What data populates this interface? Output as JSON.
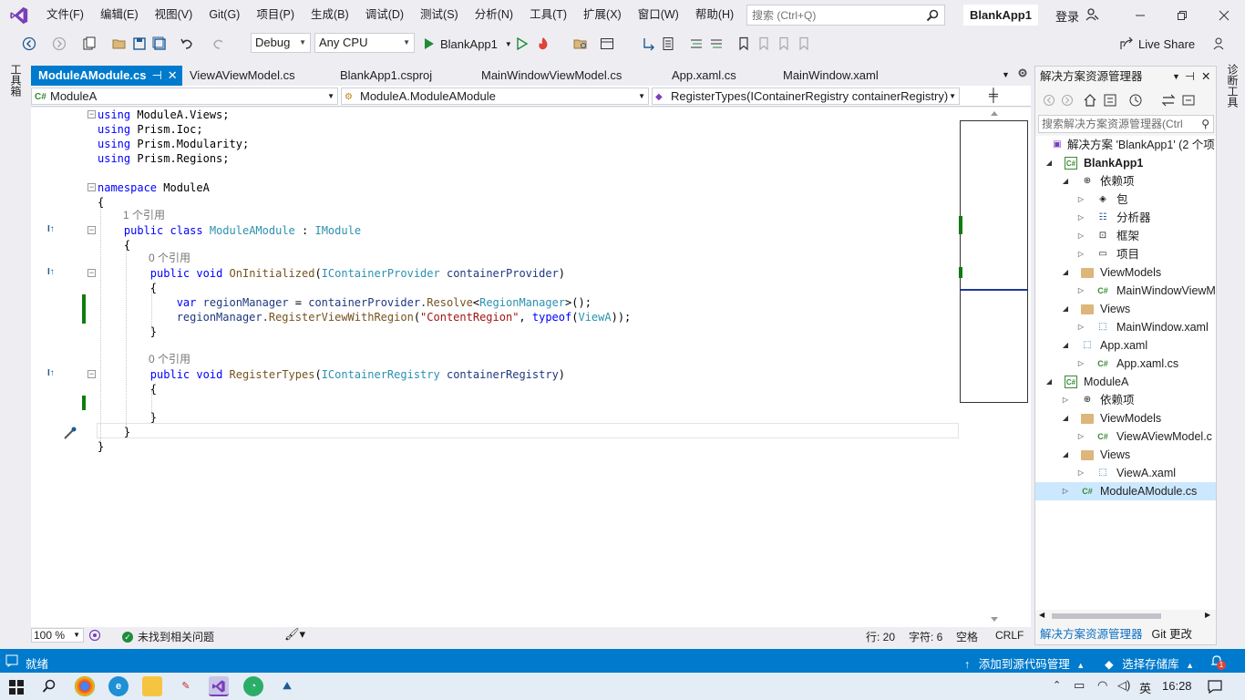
{
  "menubar": {
    "items": [
      "文件(F)",
      "编辑(E)",
      "视图(V)",
      "Git(G)",
      "项目(P)",
      "生成(B)",
      "调试(D)",
      "测试(S)",
      "分析(N)",
      "工具(T)",
      "扩展(X)",
      "窗口(W)",
      "帮助(H)"
    ],
    "search_placeholder": "搜索 (Ctrl+Q)",
    "solution_name": "BlankApp1",
    "login": "登录"
  },
  "toolbar": {
    "config": "Debug",
    "platform": "Any CPU",
    "run_target": "BlankApp1",
    "live_share": "Live Share"
  },
  "left_strip": {
    "toolbox": "工具箱"
  },
  "right_strip": {
    "diagnostics": "诊断工具"
  },
  "doc_tabs": [
    {
      "label": "ModuleAModule.cs",
      "active": true
    },
    {
      "label": "ViewAViewModel.cs"
    },
    {
      "label": "BlankApp1.csproj"
    },
    {
      "label": "MainWindowViewModel.cs"
    },
    {
      "label": "App.xaml.cs"
    },
    {
      "label": "MainWindow.xaml"
    }
  ],
  "nav_bar": {
    "project": "ModuleA",
    "type": "ModuleA.ModuleAModule",
    "member": "RegisterTypes(IContainerRegistry containerRegistry)"
  },
  "code": {
    "using1": "using",
    "ns1": "ModuleA.Views;",
    "using2": "using",
    "ns2": "Prism.Ioc;",
    "using3": "using",
    "ns3": "Prism.Modularity;",
    "using4": "using",
    "ns4": "Prism.Regions;",
    "namespace_kw": "namespace",
    "namespace_name": "ModuleA",
    "ref1": "1 个引用",
    "ref2": "0 个引用",
    "ref3": "0 个引用",
    "public": "public",
    "class": "class",
    "void": "void",
    "var": "var",
    "typeof": "typeof",
    "class_name": "ModuleAModule",
    "colon": ":",
    "interface": "IModule",
    "m1": "OnInitialized",
    "m1_ptype": "IContainerProvider",
    "m1_pname": "containerProvider",
    "m2": "RegisterTypes",
    "m2_ptype": "IContainerRegistry",
    "m2_pname": "containerRegistry",
    "l_var_name": "regionManager",
    "l_eq": " = ",
    "l_cp": "containerProvider.",
    "l_resolve": "Resolve",
    "l_lt": "<",
    "l_rm": "RegionManager",
    "l_gt": ">();",
    "l2_rm": "regionManager.",
    "l2_method": "RegisterViewWithRegion",
    "l2_open": "(",
    "l2_str": "\"ContentRegion\"",
    "l2_comma": ", ",
    "l2_viewa": "ViewA",
    "l2_close": "));"
  },
  "editor_status": {
    "zoom": "100 %",
    "issues": "未找到相关问题",
    "line": "行: 20",
    "char": "字符: 6",
    "whitespace": "空格",
    "eol": "CRLF"
  },
  "solution_explorer": {
    "title": "解决方案资源管理器",
    "search_placeholder": "搜索解决方案资源管理器(Ctrl",
    "items": [
      {
        "label": "解决方案 'BlankApp1' (2 个项",
        "icon": "solution-icon"
      },
      {
        "label": "BlankApp1",
        "icon": "project-icon",
        "bold": true
      },
      {
        "label": "依赖项",
        "icon": "dependencies-icon"
      },
      {
        "label": "包",
        "icon": "package-icon"
      },
      {
        "label": "分析器",
        "icon": "analyzer-icon"
      },
      {
        "label": "框架",
        "icon": "framework-icon"
      },
      {
        "label": "项目",
        "icon": "project-ref-icon"
      },
      {
        "label": "ViewModels",
        "icon": "folder-icon"
      },
      {
        "label": "MainWindowViewM",
        "icon": "csharp-file-icon"
      },
      {
        "label": "Views",
        "icon": "folder-icon"
      },
      {
        "label": "MainWindow.xaml",
        "icon": "xaml-file-icon"
      },
      {
        "label": "App.xaml",
        "icon": "xaml-file-icon"
      },
      {
        "label": "App.xaml.cs",
        "icon": "csharp-file-icon"
      },
      {
        "label": "ModuleA",
        "icon": "project-icon"
      },
      {
        "label": "依赖项",
        "icon": "dependencies-icon"
      },
      {
        "label": "ViewModels",
        "icon": "folder-icon"
      },
      {
        "label": "ViewAViewModel.c",
        "icon": "csharp-file-icon"
      },
      {
        "label": "Views",
        "icon": "folder-icon"
      },
      {
        "label": "ViewA.xaml",
        "icon": "xaml-file-icon"
      },
      {
        "label": "ModuleAModule.cs",
        "icon": "csharp-file-icon"
      }
    ],
    "bottom_tabs": [
      "解决方案资源管理器",
      "Git 更改"
    ]
  },
  "statusbar": {
    "ready": "就绪",
    "add_source": "添加到源代码管理",
    "select_repo": "选择存储库",
    "notifications": "1"
  },
  "taskbar": {
    "ime": "英",
    "time": "16:28"
  },
  "colors": {
    "accent": "#007acc",
    "change_bar": "#107c10",
    "selected_row": "#cce8ff"
  }
}
